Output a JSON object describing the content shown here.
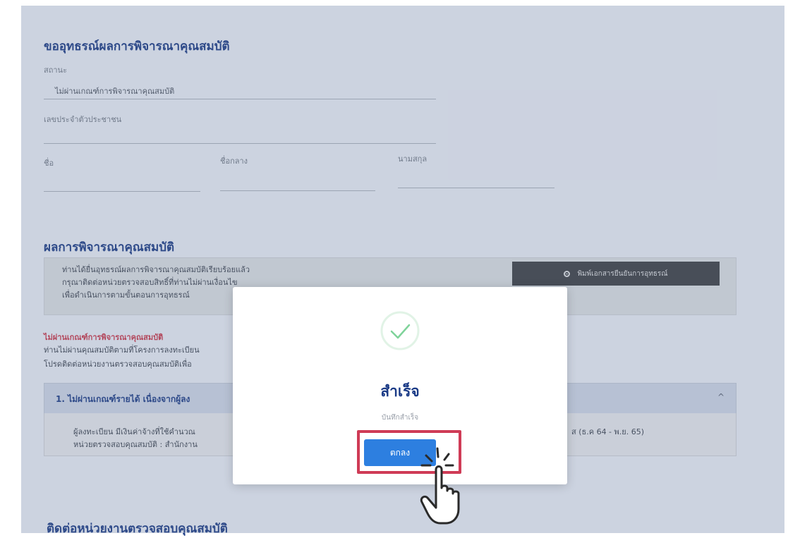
{
  "form": {
    "title": "ขออุทธรณ์ผลการพิจารณาคุณสมบัติ",
    "status_label": "สถานะ",
    "status_value": "ไม่ผ่านเกณฑ์การพิจารณาคุณสมบัติ",
    "citizen_id_label": "เลขประจำตัวประชาชน",
    "first_name_label": "ชื่อ",
    "middle_name_label": "ชื่อกลาง",
    "last_name_label": "นามสกุล"
  },
  "result": {
    "title": "ผลการพิจารณาคุณสมบัติ",
    "info_lines": [
      "ท่านได้ยื่นอุทธรณ์ผลการพิจารณาคุณสมบัติเรียบร้อยแล้ว",
      "กรุณาติดต่อหน่วยตรวจสอบสิทธิ์ที่ท่านไม่ผ่านเงื่อนไข",
      "เพื่อดำเนินการตามขั้นตอนการอุทธรณ์"
    ],
    "print_button": "พิมพ์เอกสารยืนยันการอุทธรณ์",
    "fail_heading": "ไม่ผ่านเกณฑ์การพิจารณาคุณสมบัติ",
    "fail_lines": [
      "ท่านไม่ผ่านคุณสมบัติตามที่โครงการลงทะเบียน",
      "โปรดติดต่อหน่วยงานตรวจสอบคุณสมบัติเพื่อ"
    ],
    "accordion_title": "1. ไม่ผ่านเกณฑ์รายได้ เนื่องจากผู้ลง",
    "accordion_chevron": "^",
    "accordion_body": [
      "ผู้ลงทะเบียน มีเงินค่าจ้างที่ใช้คำนวณ",
      "หน่วยตรวจสอบคุณสมบัติ : สำนักงาน"
    ],
    "accordion_right": "ส (ธ.ค 64 - พ.ย. 65)"
  },
  "contact": {
    "title": "ติดต่อหน่วยงานตรวจสอบคุณสมบัติ"
  },
  "modal": {
    "title": "สำเร็จ",
    "subtitle": "บันทึกสำเร็จ",
    "ok_button": "ตกลง"
  },
  "icons": {
    "success": "check-circle-icon",
    "cursor": "pointing-hand-icon"
  },
  "colors": {
    "primary_text": "#1a3a86",
    "ok_button": "#2d7fe0",
    "highlight": "#cf3b56",
    "success_check": "#7fd39a",
    "error_text": "#c4374c"
  }
}
